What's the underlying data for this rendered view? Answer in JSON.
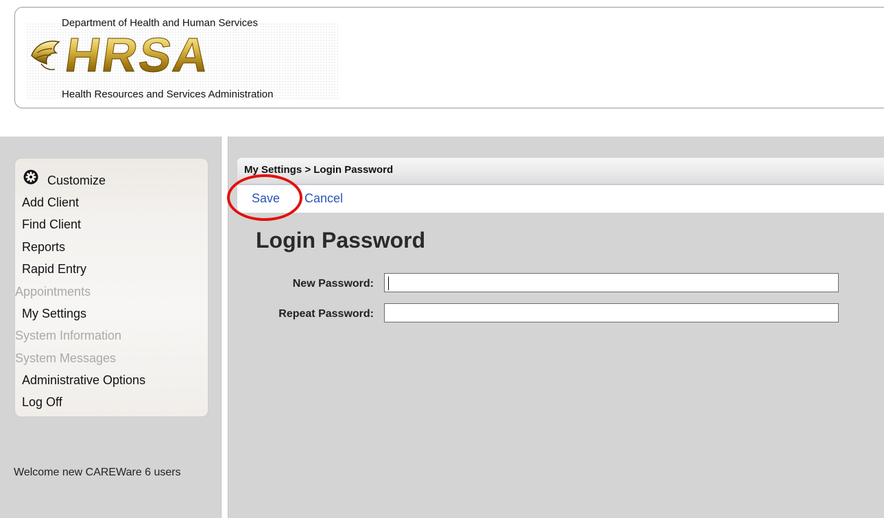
{
  "header": {
    "org_top": "Department of Health and Human Services",
    "logo_letters": "HRSA",
    "org_bottom": "Health Resources and Services Administration"
  },
  "sidebar": {
    "customize_label": "Customize",
    "customize_icon": "gear-icon",
    "items": [
      {
        "label": "Add Client",
        "enabled": true
      },
      {
        "label": "Find Client",
        "enabled": true
      },
      {
        "label": "Reports",
        "enabled": true
      },
      {
        "label": "Rapid Entry",
        "enabled": true
      },
      {
        "label": "Appointments",
        "enabled": false
      },
      {
        "label": "My Settings",
        "enabled": true
      },
      {
        "label": "System Information",
        "enabled": false
      },
      {
        "label": "System Messages",
        "enabled": false
      },
      {
        "label": "Administrative Options",
        "enabled": true
      },
      {
        "label": "Log Off",
        "enabled": true
      }
    ],
    "welcome_text": "Welcome new CAREWare 6 users"
  },
  "main": {
    "breadcrumb": "My Settings > Login Password",
    "toolbar": {
      "save_label": "Save",
      "cancel_label": "Cancel"
    },
    "page_title": "Login Password",
    "fields": {
      "new_password_label": "New Password:",
      "new_password_value": "",
      "repeat_password_label": "Repeat Password:",
      "repeat_password_value": ""
    }
  },
  "colors": {
    "link": "#2a56b8",
    "highlight_ring": "#e3100d",
    "panel_gray": "#d4d4d4",
    "disabled_text": "#a9a9a9"
  }
}
